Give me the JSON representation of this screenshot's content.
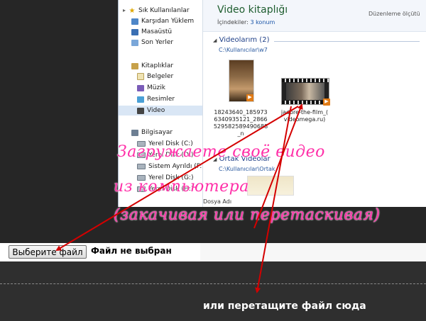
{
  "explorer": {
    "nav": {
      "favorites_header": "Sık Kullanılanlar",
      "favorites": [
        "Karşıdan Yüklem",
        "Masaüstü",
        "Son Yerler"
      ],
      "libraries_header": "Kitaplıklar",
      "libraries": [
        "Belgeler",
        "Müzik",
        "Resimler",
        "Video"
      ],
      "computer_header": "Bilgisayar",
      "drives": [
        "Yerel Disk (C:)",
        "Yerel Disk (D:)",
        "Sistem Ayrıldı (F:",
        "Yerel Disk (G:)",
        "Yerel Disk (H:)"
      ]
    },
    "library": {
      "title": "Video kitaplığı",
      "includes_label": "İçindekiler:",
      "includes_link": "3 konum",
      "arrange_label": "Düzenleme ölçütü"
    },
    "groups": [
      {
        "title": "Videolarım (2)",
        "path": "C:\\Kullanıcılar\\w7",
        "files": [
          "18243640_185973 6340935121_2866 529582589490688 _n",
          "jadore-the-film_( videomega.ru)"
        ]
      },
      {
        "title": "Ortak Videolar",
        "path": "C:\\Kullanıcılar\\Ortak"
      }
    ],
    "filename_label": "Dosya Adı"
  },
  "upload": {
    "choose_button": "Выберите файл",
    "no_file": "Файл не выбран",
    "drop_text": "или перетащите файл сюда"
  },
  "annotation": {
    "line1": "Загружаете своё видео",
    "line2": "из компьютера",
    "line3": "(закачивая или перетаскивая)"
  },
  "colors": {
    "annotation": "#ff2fa8",
    "arrow": "#d40000",
    "page_bg": "#2b2b2b"
  }
}
